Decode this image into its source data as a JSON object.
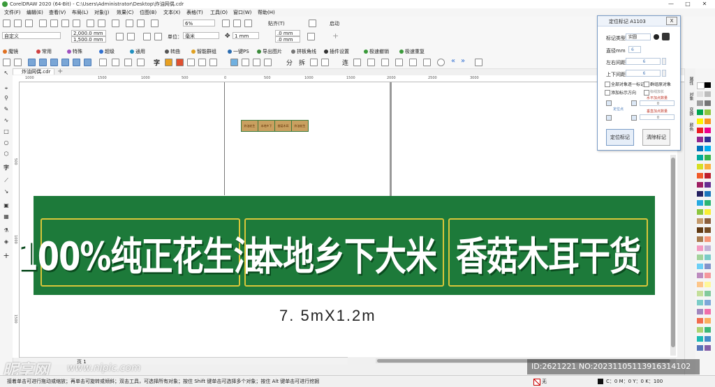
{
  "window": {
    "title": "CorelDRAW 2020 (64-Bit) - C:\\Users\\Administrator\\Desktop\\炸油网偶.cdr",
    "minimize": "—",
    "maximize": "□",
    "close": "✕"
  },
  "menubar": {
    "items": [
      "文件(F)",
      "编辑(E)",
      "查看(V)",
      "布局(L)",
      "对象(J)",
      "效果(C)",
      "位图(B)",
      "文本(X)",
      "表格(T)",
      "工具(O)",
      "窗口(W)",
      "帮助(H)"
    ]
  },
  "toolbar1": {
    "zoom": "6%",
    "snap_label": "贴齐(T)",
    "launch_label": "启动"
  },
  "propertybar": {
    "preset": "自定义",
    "width": "2,000.0 mm",
    "height": "1,500.0 mm",
    "units_label": "单位：",
    "units_value": "毫米",
    "nudge": "1 mm",
    "dup_x": ".0 mm",
    "dup_y": ".0 mm"
  },
  "plugins": {
    "items": [
      "魔镜",
      "常用",
      "特殊",
      "超级",
      "通用",
      "转曲",
      "智能群组",
      "一键PS",
      "导出图片",
      "拼板角线",
      "插件设置",
      "极速撤销",
      "极速重复"
    ]
  },
  "document": {
    "tab_label": "炸油网偶.cdr",
    "page_tab": "页 1",
    "ruler_top": [
      "1000",
      "1500",
      "1000",
      "500",
      "0",
      "500",
      "1000",
      "1500",
      "2000",
      "2500",
      "3000"
    ],
    "ruler_left": [
      "500",
      "1000",
      "1500"
    ]
  },
  "thumbnail": {
    "items": [
      "炸油花生",
      "本地乡下",
      "香菇木耳",
      "炸油花生"
    ]
  },
  "sign": {
    "panels": [
      "100%纯正花生油",
      "本地乡下大米",
      "香菇木耳干货"
    ],
    "dimensions": "7. 5mX1.2m",
    "bg_color": "#1d7a3a",
    "border_color": "#d9c63a"
  },
  "dialog": {
    "title": "定位标记 A1103",
    "close": "X",
    "mark_type_label": "标记类型",
    "mark_type_value": "实圆",
    "diameter_label": "直径mm",
    "diameter_value": "6",
    "lr_margin_label": "左右间距",
    "lr_margin_value": "6",
    "tb_margin_label": "上下间距",
    "tb_margin_value": "6",
    "opt_all_objects": "全部对象逐一标记",
    "opt_group_origin": "群组原对象",
    "opt_add_direction": "添加标示方向",
    "opt_mark_add": "标线加长",
    "h_add_count": "水平加点数量",
    "locate_point": "定位点",
    "v_add_count": "垂直加点数量",
    "h_count_value": "0",
    "v_count_value": "0",
    "btn_mark": "定位标记",
    "btn_clear": "清除标记"
  },
  "right_dock": {
    "tabs": [
      "属性",
      "对象",
      "变换",
      "颜色"
    ]
  },
  "statusbar": {
    "hint": "接着单击可进行拖动或缩放；再单击可旋转或倾斜；双击工具，可选择所有对象；按住 Shift 键单击可选择多个对象；按住 Alt 键单击可进行挖掘",
    "fill_label": "无",
    "cmyk": "C：0 M：0 Y：0 K：100"
  },
  "watermark": {
    "brand": "昵享网",
    "url": "www.nipic.com",
    "id_text": "ID:2621221 NO:20231105113916314102"
  }
}
